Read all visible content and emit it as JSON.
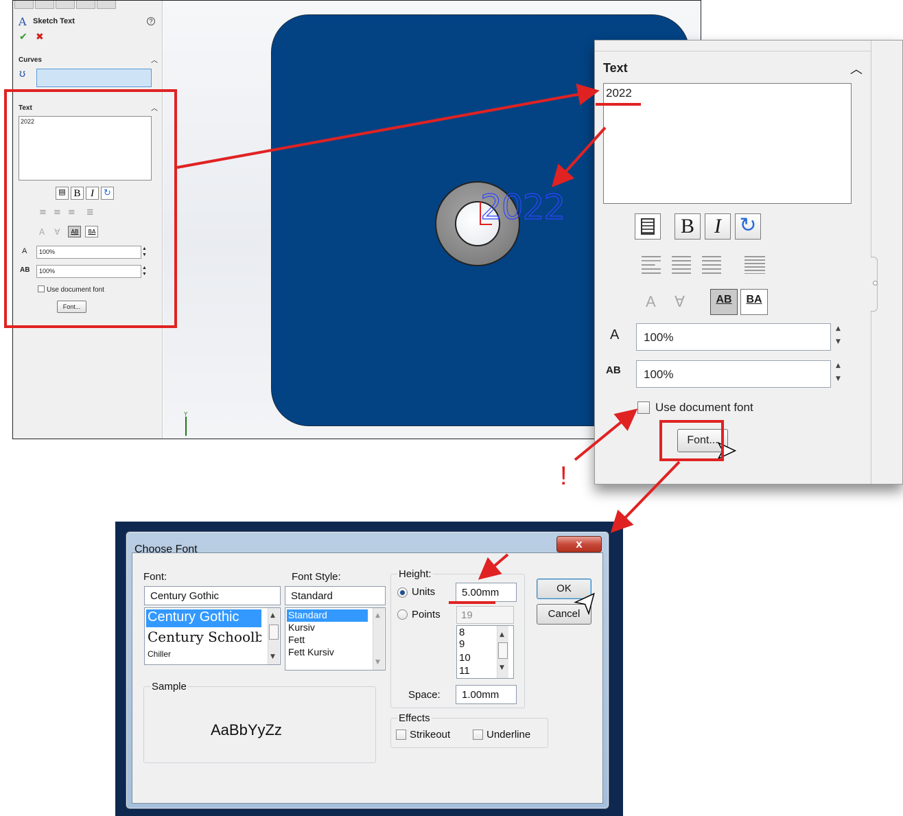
{
  "sketch_panel": {
    "title": "Sketch Text",
    "curves_label": "Curves",
    "text_label": "Text",
    "text_value": "2022",
    "height_value": "100%",
    "spacing_value": "100%",
    "use_document_font": "Use document font",
    "font_button": "Font...",
    "help_icon": "?"
  },
  "viewport": {
    "preview_text": "2022",
    "axis_label": "Y"
  },
  "zoom_panel": {
    "text_label": "Text",
    "text_value": "2022",
    "bold_label": "B",
    "italic_label": "I",
    "height_value": "100%",
    "spacing_value": "100%",
    "use_document_font": "Use document font",
    "font_button": "Font...",
    "flip_label_1": "AB",
    "flip_label_2": "BA"
  },
  "annotation": {
    "exclamation": "!",
    "color": "#e02222"
  },
  "font_dialog": {
    "title": "Choose Font",
    "close_icon": "x",
    "font_label": "Font:",
    "font_value": "Century Gothic",
    "font_list": [
      "Century Gothic",
      "Century Schoolbook",
      "Chiller"
    ],
    "style_label": "Font Style:",
    "style_value": "Standard",
    "style_list": [
      "Standard",
      "Kursiv",
      "Fett",
      "Fett Kursiv"
    ],
    "height_label": "Height:",
    "units_label": "Units",
    "units_value": "5.00mm",
    "points_label": "Points",
    "points_value": "19",
    "points_list": [
      "8",
      "9",
      "10",
      "11"
    ],
    "space_label": "Space:",
    "space_value": "1.00mm",
    "ok_label": "OK",
    "cancel_label": "Cancel",
    "sample_label": "Sample",
    "sample_text": "AaBbYyZz",
    "effects_label": "Effects",
    "strikeout_label": "Strikeout",
    "underline_label": "Underline"
  },
  "colors": {
    "plate": "#034384",
    "accent_red": "#e02222",
    "selection_blue": "#3399ff"
  }
}
